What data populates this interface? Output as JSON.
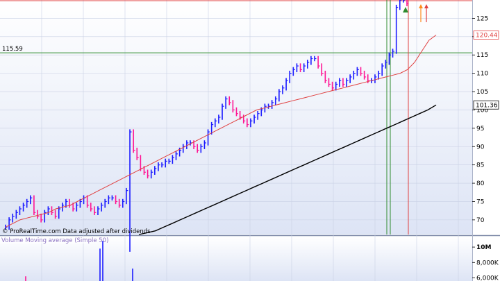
{
  "chart_data": [
    {
      "type": "line",
      "title": "",
      "attribution": "© ProRealTime.com  Data adjusted after dividends",
      "ylim": [
        66,
        130
      ],
      "y_ticks": [
        70,
        75,
        80,
        85,
        90,
        95,
        100,
        105,
        110,
        115,
        120,
        125
      ],
      "horizontal_levels": [
        {
          "value": 115.59,
          "label": "115.59",
          "color": "#2e8b2e"
        },
        {
          "value": 130.0,
          "label": "",
          "color": "#e04040"
        }
      ],
      "value_tags": [
        {
          "value": 120.44,
          "label": "120.44",
          "color": "#e04040"
        },
        {
          "value": 101.36,
          "label": "101.36",
          "color": "#000000"
        }
      ],
      "series": [
        {
          "kind": "price",
          "values": [
            68,
            70,
            71,
            72,
            73,
            74,
            75,
            76,
            72,
            71,
            70,
            72,
            73,
            72,
            71,
            73,
            74,
            75,
            74,
            73,
            74,
            75,
            76,
            74,
            73,
            72,
            73,
            74,
            75,
            76,
            76,
            75,
            74,
            75,
            78,
            94,
            89,
            87,
            84,
            83,
            82,
            83,
            84,
            85,
            85,
            86,
            86,
            87,
            88,
            89,
            90,
            91,
            91,
            90,
            89,
            90,
            91,
            94,
            96,
            97,
            98,
            101,
            103,
            102,
            100,
            99,
            98,
            97,
            96,
            97,
            98,
            99,
            100,
            101,
            101,
            102,
            103,
            105,
            106,
            108,
            110,
            111,
            112,
            111,
            112,
            113,
            114,
            114,
            112,
            110,
            108,
            107,
            106,
            107,
            108,
            107,
            108,
            109,
            110,
            111,
            110,
            109,
            108,
            108,
            109,
            110,
            112,
            113,
            115,
            116,
            128,
            130,
            130,
            129
          ]
        },
        {
          "kind": "moving-average-fast",
          "color": "#e04040",
          "values": [
            68,
            69,
            70,
            70.5,
            71,
            71.5,
            72,
            73,
            73.5,
            74,
            75,
            76,
            77,
            78,
            79,
            80,
            81,
            82,
            83,
            84,
            85,
            86,
            87,
            88,
            89,
            90,
            91,
            92,
            93,
            94,
            95,
            96,
            97,
            98,
            99,
            100,
            100.5,
            101,
            101.5,
            102,
            102.5,
            103,
            103.5,
            104,
            104.5,
            105,
            105.5,
            106,
            106.5,
            107,
            107.5,
            108,
            108.5,
            109,
            109.5,
            110,
            111,
            113,
            116,
            119,
            120.44
          ]
        },
        {
          "kind": "moving-average-slow",
          "color": "#000000",
          "values": [
            66,
            66.5,
            67,
            68,
            69,
            70,
            71,
            72,
            73,
            74,
            75,
            76,
            77,
            78,
            79,
            80,
            81,
            82,
            83,
            84,
            85,
            86,
            87,
            88,
            89,
            90,
            91,
            92,
            93,
            94,
            95,
            96,
            97,
            98,
            99,
            100,
            101.36
          ]
        }
      ],
      "signals": [
        {
          "kind": "arrow-up",
          "color": "#2e8b2e",
          "index": 0
        },
        {
          "kind": "arrow-up",
          "color": "#ff8c1a",
          "index": 1
        },
        {
          "kind": "arrow-up",
          "color": "#e04040",
          "index": 2
        }
      ],
      "vertical_markers": [
        {
          "color": "#2e8b2e"
        },
        {
          "color": "#2e8b2e"
        },
        {
          "color": "#e04040"
        }
      ]
    },
    {
      "type": "bar",
      "title": "Volume Moving average (Simple 50)",
      "ylim": [
        0,
        11000000
      ],
      "y_ticks": [
        {
          "value": 10000000,
          "label": "10M"
        },
        {
          "value": 8000000,
          "label": "8,000K"
        },
        {
          "value": 6000000,
          "label": "6,000K"
        }
      ],
      "spikes": [
        {
          "value": 6200000,
          "color": "#ff1493"
        },
        {
          "value": 9800000,
          "color": "#1a1aff"
        },
        {
          "value": 10800000,
          "color": "#1a1aff"
        },
        {
          "value": 7200000,
          "color": "#1a1aff"
        }
      ]
    }
  ]
}
